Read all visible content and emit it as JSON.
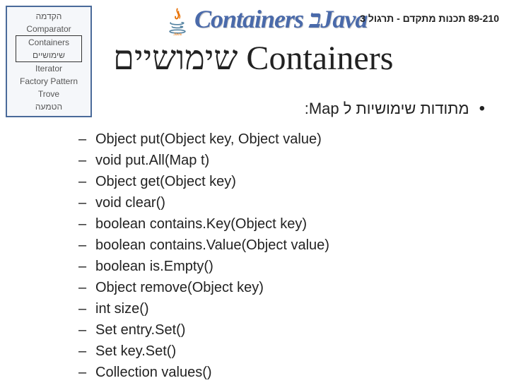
{
  "nav": {
    "items": [
      {
        "label": "הקדמה",
        "selected": false
      },
      {
        "label": "Comparator",
        "selected": false
      },
      {
        "label": "Containers שימושיים",
        "selected": true
      },
      {
        "label": "Iterator",
        "selected": false
      },
      {
        "label": "Factory Pattern",
        "selected": false
      },
      {
        "label": "Trove",
        "selected": false
      },
      {
        "label": "הטמעה",
        "selected": false
      }
    ]
  },
  "heading_graphic": "Containersב Java",
  "course_info": "89-210 תכנות מתקדם - תרגול 3",
  "slide_title": "Containers שימושיים",
  "bullet_text": "מתודות שימושיות ל Map:",
  "methods": [
    "Object put(Object key, Object value)",
    "void put.All(Map t)",
    "Object get(Object key)",
    "void clear()",
    "boolean contains.Key(Object key)",
    "boolean contains.Value(Object value)",
    "boolean is.Empty()",
    "Object remove(Object key)",
    "int size()",
    "Set entry.Set()",
    "Set key.Set()",
    "Collection values()"
  ]
}
